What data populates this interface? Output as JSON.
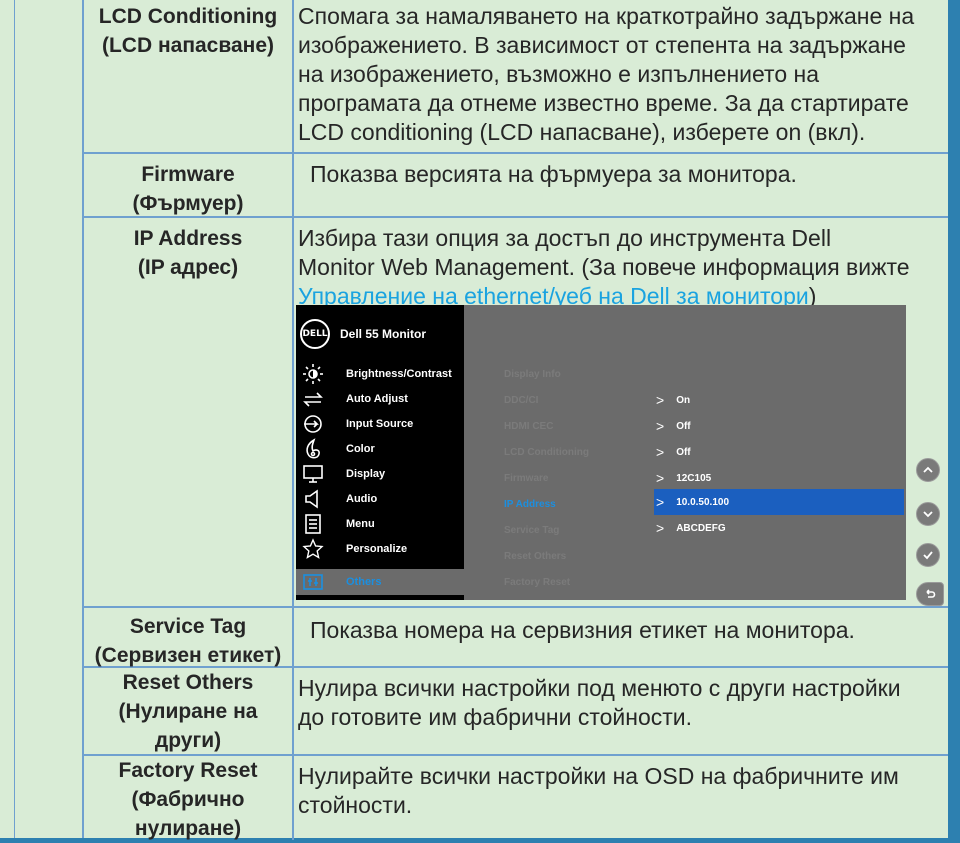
{
  "rows": [
    {
      "name_lines": [
        "LCD Conditioning",
        "(LCD напасване)"
      ],
      "desc_lines": [
        "Спомага за намаляването на краткотрайно задържане на",
        "изображението. В зависимост от степента на задържане",
        "на изображението, възможно е изпълнението на",
        "програмата да отнеме известно време. За да стартирате",
        "LCD conditioning (LCD напасване), изберете on (вкл)."
      ]
    },
    {
      "name_lines": [
        "Firmware",
        "(Фърмуер)"
      ],
      "desc_lines": [
        "Показва версията на фърмуера за монитора."
      ]
    },
    {
      "name_lines": [
        "IP Address",
        "(IP адрес)"
      ],
      "desc_lines": [
        "Избира тази опция за достъп до инструмента Dell",
        "Monitor Web Management. (За повече информация вижте"
      ],
      "link_text": "Управление на ethernet/уеб на Dell за монитори",
      "link_suffix": ")"
    },
    {
      "name_lines": [
        "Service Tag",
        "(Сервизен етикет)"
      ],
      "desc_lines": [
        "Показва номера на сервизния етикет на монитора."
      ]
    },
    {
      "name_lines": [
        "Reset Others",
        "(Нулиране на",
        "други)"
      ],
      "desc_lines": [
        "Нулира всички настройки под менюто с други настройки",
        "до готовите им фабрични стойности."
      ]
    },
    {
      "name_lines": [
        "Factory Reset",
        "(Фабрично",
        "нулиране)"
      ],
      "desc_lines": [
        "Нулирайте всички настройки на OSD на фабричните им",
        "стойности."
      ]
    }
  ],
  "osd": {
    "logo": "DELL",
    "title": "Dell 55 Monitor",
    "menu": [
      {
        "label": "Brightness/Contrast",
        "icon": "brightness-icon"
      },
      {
        "label": "Auto Adjust",
        "icon": "auto-adjust-icon"
      },
      {
        "label": "Input Source",
        "icon": "input-source-icon"
      },
      {
        "label": "Color",
        "icon": "color-icon"
      },
      {
        "label": "Display",
        "icon": "display-icon"
      },
      {
        "label": "Audio",
        "icon": "audio-icon"
      },
      {
        "label": "Menu",
        "icon": "menu-icon"
      },
      {
        "label": "Personalize",
        "icon": "star-icon"
      },
      {
        "label": "Others",
        "icon": "others-icon",
        "active": true
      }
    ],
    "options": [
      "Display Info",
      "DDC/CI",
      "HDMI CEC",
      "LCD Conditioning",
      "Firmware",
      "IP Address",
      "Service Tag",
      "Reset Others",
      "Factory Reset"
    ],
    "values": [
      "On",
      "Off",
      "Off",
      "12C105",
      "10.0.50.100",
      "ABCDEFG"
    ],
    "selected_option": "IP Address",
    "nav_buttons": [
      "up-arrow-icon",
      "down-arrow-icon",
      "check-icon",
      "back-icon"
    ],
    "colors": {
      "panel": "#6b6b6b",
      "sidebar": "#000000",
      "selection": "#1b5fbf",
      "highlight_text": "#1b8fe0"
    }
  },
  "colors": {
    "page_bg": "#d9ecd6",
    "border": "#6fa0cf",
    "right_band": "#2d80b0",
    "link": "#1aa3e0"
  }
}
